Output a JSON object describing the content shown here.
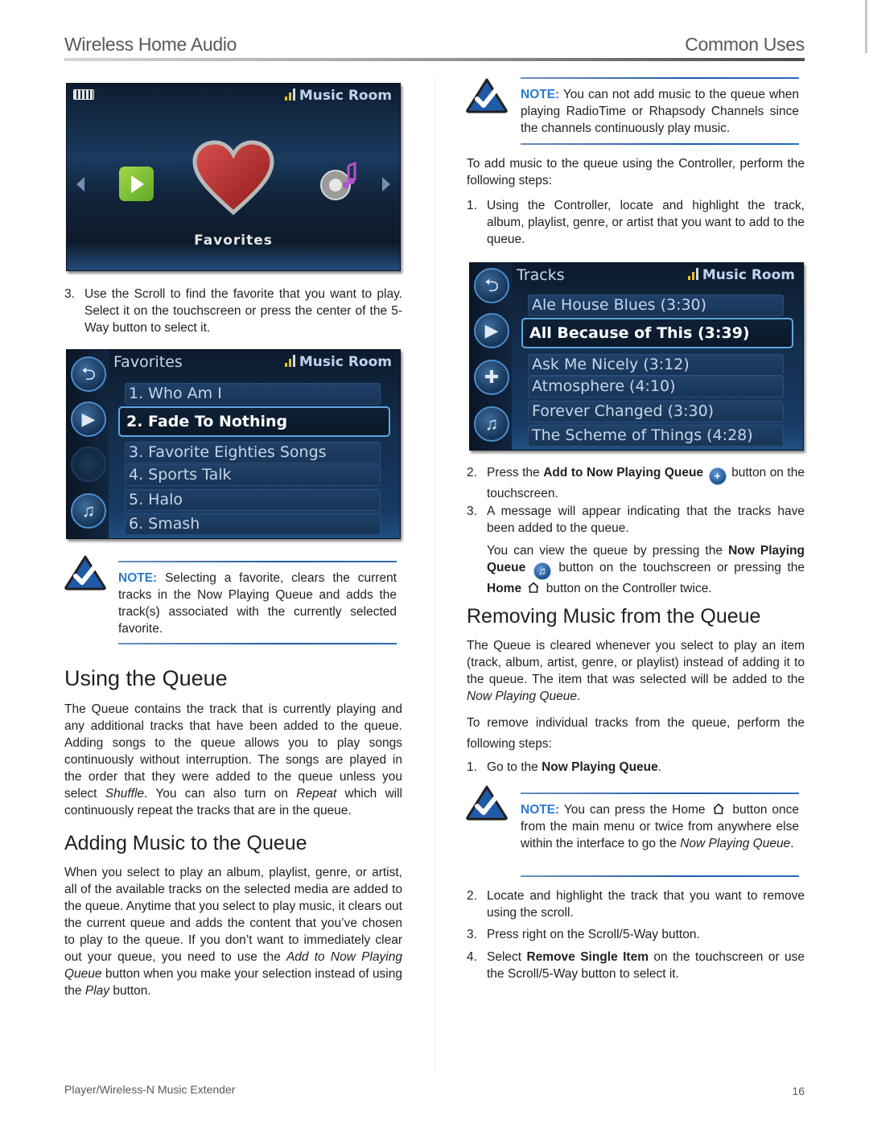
{
  "header": {
    "left": "Wireless Home Audio",
    "right": "Common Uses"
  },
  "footer": {
    "left": "Player/Wireless-N Music Extender",
    "page_number": "16"
  },
  "colors": {
    "note_accent": "#2b7ccd",
    "rule_blue": "#1f5aa6",
    "screen_bg": "#142e4d",
    "selection_border": "#5fa7e0"
  },
  "screen_home": {
    "room": "Music Room",
    "center_label": "Favorites",
    "icons": [
      "battery-icon",
      "signal-icon",
      "left-arrow-icon",
      "play-tile-icon",
      "heart-favorites-icon",
      "speaker-music-icon",
      "right-arrow-icon"
    ]
  },
  "left": {
    "step3_num": "3.",
    "step3_text": "Use the Scroll to find the favorite that you want to play. Select it on the touchscreen or press the center of the 5-Way button to select it.",
    "screen_favorites": {
      "title": "Favorites",
      "room": "Music Room",
      "items": [
        "1. Who Am I",
        "2. Fade To Nothing",
        "3. Favorite Eighties Songs",
        "4. Sports Talk",
        "5. Halo",
        "6. Smash"
      ],
      "selected_index": 1
    },
    "note1": {
      "label": "NOTE:",
      "text": " Selecting a favorite, clears the current tracks in the Now Playing Queue and adds the track(s) associated with the currently selected favorite."
    },
    "using_queue": {
      "heading": "Using the Queue",
      "p1_a": "The Queue contains the track that is currently playing and any additional tracks that have been added to the queue. Adding songs to the queue allows you to play songs continuously without interruption. The songs are played in the order that they were added to the queue unless you select ",
      "p1_shuffle": "Shuffle",
      "p1_b": ". You can also turn on ",
      "p1_repeat": "Repeat",
      "p1_c": " which will continuously repeat the tracks that are in the queue."
    },
    "adding": {
      "heading": "Adding Music to the Queue",
      "p_a": "When you select to play an album, playlist, genre, or artist, all of the available tracks on the selected media are added to the queue. Anytime that you select to play music, it clears out the current queue and adds the content that you’ve chosen to play to the queue. If you don’t want to immediately clear out your queue, you need to use the ",
      "p_italic1": "Add to Now Playing Queue",
      "p_b": " button when you make your selection instead of using the ",
      "p_italic2": "Play",
      "p_c": " button."
    }
  },
  "right": {
    "note2": {
      "label": "NOTE:",
      "text": " You can not add music to the queue when playing RadioTime or Rhapsody Channels since the channels continuously play music."
    },
    "intro": "To add music to the queue using the Controller, perform the following steps:",
    "step1_num": "1.",
    "step1": "Using the Controller, locate and highlight the track, album, playlist, genre, or artist that you want to add to the queue.",
    "screen_tracks": {
      "title": "Tracks",
      "room": "Music Room",
      "items": [
        "Ale House Blues (3:30)",
        "All Because of This (3:39)",
        "Ask Me Nicely (3:12)",
        "Atmosphere (4:10)",
        "Forever Changed (3:30)",
        "The Scheme of Things (4:28)"
      ],
      "selected_index": 1
    },
    "step2_num": "2.",
    "step2_a": "Press the ",
    "step2_bold": "Add to Now Playing Queue",
    "step2_b": " button on the touchscreen.",
    "step3_num": "3.",
    "step3": "A message will appear indicating that the tracks have been added to the queue.",
    "step3_extra_a": "You can view the queue by pressing the ",
    "step3_extra_bold1": "Now Playing Queue",
    "step3_extra_b": " button on the touchscreen or pressing the ",
    "step3_extra_bold2": "Home",
    "step3_extra_c": " button on the Controller twice.",
    "removing": {
      "heading": "Removing Music from the Queue",
      "p1_a": "The Queue is cleared whenever you select to play an item (track, album, artist, genre, or playlist) instead of adding it to the queue. The item that was selected will be added to the ",
      "p1_italic": "Now Playing Queue",
      "p1_b": ".",
      "p2": "To remove individual tracks from the queue, perform the following steps:",
      "step1_num": "1.",
      "step1_a": "Go to the ",
      "step1_bold": "Now Playing Queue",
      "step1_b": ".",
      "note3": {
        "label": "NOTE:",
        "text_a": " You can press the Home ",
        "text_b": " button once from the main menu or twice from anywhere else within the interface to go the ",
        "text_italic": "Now Playing Queue",
        "text_c": "."
      },
      "step2_num": "2.",
      "step2": "Locate and highlight the track that you want to remove using the scroll.",
      "step3_num": "3.",
      "step3": "Press right on the Scroll/5-Way button.",
      "step4_num": "4.",
      "step4_a": "Select ",
      "step4_bold": "Remove Single Item",
      "step4_b": " on the touchscreen or use the Scroll/5-Way button to select it."
    }
  }
}
